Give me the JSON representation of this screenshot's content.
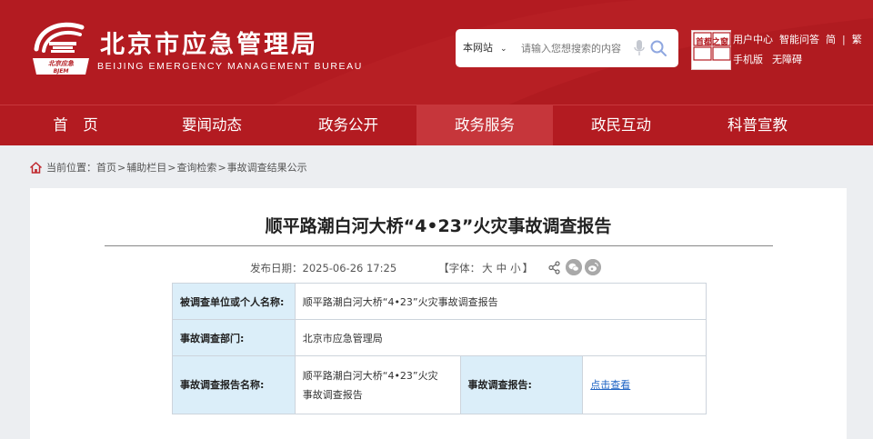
{
  "header": {
    "site_title": "北京市应急管理局",
    "site_subtitle": "BEIJING EMERGENCY MANAGEMENT BUREAU",
    "brand_color": "#b31b21",
    "search": {
      "scope": "本网站",
      "placeholder": "请输入您想搜索的内容"
    },
    "capital_badge": {
      "text": "首都之窗",
      "caption": "Beijing·China"
    },
    "links": {
      "user_center": "用户中心",
      "smart_qa": "智能问答",
      "simplified": "简",
      "traditional": "繁",
      "mobile": "手机版",
      "accessibility": "无障碍"
    }
  },
  "nav": {
    "items": [
      {
        "label": "首　页"
      },
      {
        "label": "要闻动态"
      },
      {
        "label": "政务公开"
      },
      {
        "label": "政务服务"
      },
      {
        "label": "政民互动"
      },
      {
        "label": "科普宣教"
      }
    ],
    "active_index": 3
  },
  "breadcrumb": {
    "prefix": "当前位置：",
    "items": [
      "首页",
      "辅助栏目",
      "查询检索",
      "事故调查结果公示"
    ],
    "separator": ">"
  },
  "article": {
    "title": "顺平路潮白河大桥“4•23”火灾事故调查报告",
    "date_label": "发布日期：",
    "date": "2025-06-26 17:25",
    "font_label_open": "【字体：",
    "font_large": "大",
    "font_medium": "中",
    "font_small": "小",
    "font_label_close": "】"
  },
  "info_table": {
    "row1_label": "被调查单位或个人名称:",
    "row1_value": "顺平路潮白河大桥“4•23”火灾事故调查报告",
    "row2_label": "事故调查部门:",
    "row2_value": "北京市应急管理局",
    "row3_label": "事故调查报告名称:",
    "row3_value_line1": "顺平路潮白河大桥“4•23”火灾",
    "row3_value_line2": "事故调查报告",
    "row3_label2": "事故调查报告:",
    "row3_link": "点击查看"
  }
}
